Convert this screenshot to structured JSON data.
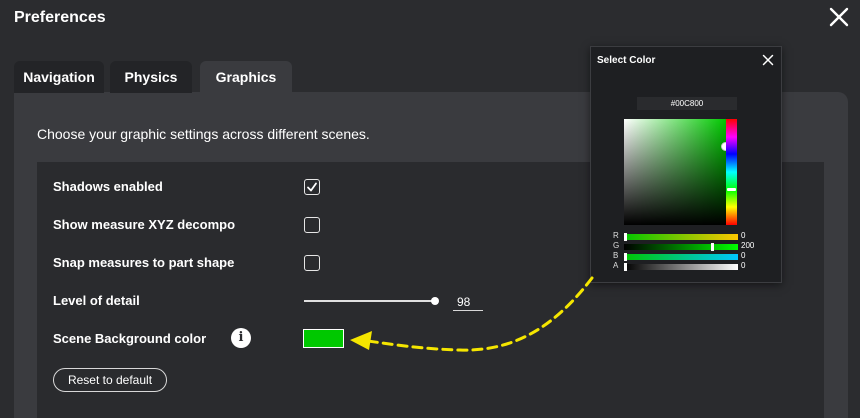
{
  "window": {
    "title": "Preferences"
  },
  "tabs": [
    {
      "label": "Navigation",
      "active": false
    },
    {
      "label": "Physics",
      "active": false
    },
    {
      "label": "Graphics",
      "active": true
    }
  ],
  "graphics": {
    "description": "Choose your graphic settings across different scenes.",
    "shadows": {
      "label": "Shadows enabled",
      "checked": true
    },
    "measure_xyz": {
      "label": "Show measure XYZ decompo",
      "checked": false
    },
    "snap_measures": {
      "label": "Snap measures to part shape",
      "checked": false
    },
    "level_of_detail": {
      "label": "Level of detail",
      "value": "98",
      "fraction": 0.98
    },
    "background_color": {
      "label": "Scene Background color",
      "info_icon": "i",
      "color": "#00C800"
    },
    "reset_label": "Reset to default"
  },
  "color_picker": {
    "title": "Select Color",
    "hex": "#00C800",
    "channels": [
      {
        "label": "R",
        "value": "0",
        "fraction": 0.0
      },
      {
        "label": "G",
        "value": "200",
        "fraction": 0.784
      },
      {
        "label": "B",
        "value": "0",
        "fraction": 0.0
      },
      {
        "label": "A",
        "value": "0",
        "fraction": 0.0
      }
    ]
  },
  "colors": {
    "background": "#2b2c2f",
    "panel": "#3a3b3f",
    "annotation_arrow": "#f5e600"
  },
  "icons": {
    "close": "close-icon",
    "checkmark": "checkmark-icon",
    "info": "info-icon"
  }
}
